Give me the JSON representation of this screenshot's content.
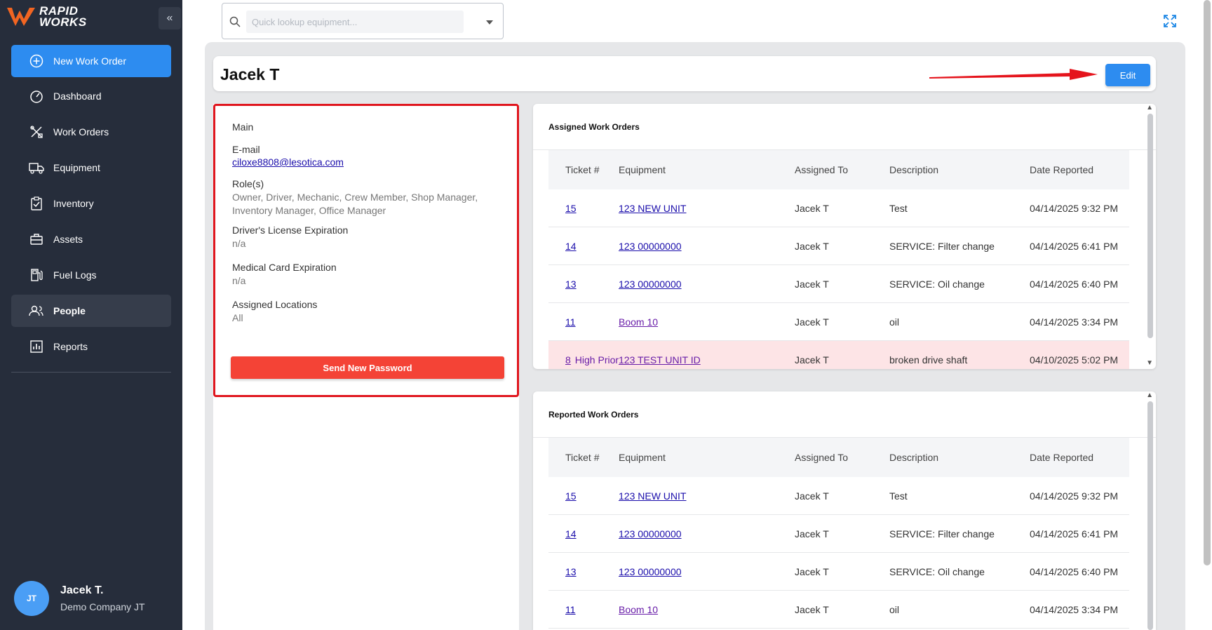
{
  "app": {
    "logo_line1": "RAPID",
    "logo_line2": "WORKS",
    "collapse_label": "«",
    "brand_color": "#f26522"
  },
  "sidebar": {
    "new_work_order": "New Work Order",
    "items": [
      {
        "label": "Dashboard",
        "icon": "gauge-icon"
      },
      {
        "label": "Work Orders",
        "icon": "tools-icon"
      },
      {
        "label": "Equipment",
        "icon": "truck-icon"
      },
      {
        "label": "Inventory",
        "icon": "clipboard-check-icon"
      },
      {
        "label": "Assets",
        "icon": "briefcase-icon"
      },
      {
        "label": "Fuel Logs",
        "icon": "fuel-pump-icon"
      },
      {
        "label": "People",
        "icon": "users-icon",
        "active": true
      },
      {
        "label": "Reports",
        "icon": "bar-chart-icon"
      }
    ],
    "user": {
      "initials": "JT",
      "name": "Jacek T.",
      "company": "Demo Company JT"
    }
  },
  "search": {
    "placeholder": "Quick lookup equipment..."
  },
  "header": {
    "title": "Jacek T",
    "edit_label": "Edit"
  },
  "profile": {
    "section": "Main",
    "email_label": "E-mail",
    "email_value": "ciloxe8808@lesotica.com",
    "roles_label": "Role(s)",
    "roles_value": "Owner, Driver, Mechanic, Crew Member, Shop Manager, Inventory Manager, Office Manager",
    "license_label": "Driver's License Expiration",
    "license_value": "n/a",
    "medical_label": "Medical Card Expiration",
    "medical_value": "n/a",
    "locations_label": "Assigned Locations",
    "locations_value": "All",
    "send_password_label": "Send New Password"
  },
  "columns": {
    "ticket": "Ticket #",
    "equipment": "Equipment",
    "assigned": "Assigned To",
    "description": "Description",
    "date": "Date Reported"
  },
  "assigned": {
    "title": "Assigned Work Orders",
    "rows": [
      {
        "ticket": "15",
        "priority": "",
        "equipment": "123 NEW UNIT",
        "assigned": "Jacek T",
        "description": "Test",
        "date": "04/14/2025 9:32 PM"
      },
      {
        "ticket": "14",
        "priority": "",
        "equipment": "123 00000000",
        "assigned": "Jacek T",
        "description": "SERVICE: Filter change",
        "date": "04/14/2025 6:41 PM"
      },
      {
        "ticket": "13",
        "priority": "",
        "equipment": "123 00000000",
        "assigned": "Jacek T",
        "description": "SERVICE: Oil change",
        "date": "04/14/2025 6:40 PM"
      },
      {
        "ticket": "11",
        "priority": "",
        "equipment": "Boom 10",
        "assigned": "Jacek T",
        "description": "oil",
        "date": "04/14/2025 3:34 PM"
      },
      {
        "ticket": "8",
        "priority": "High Prior",
        "equipment": "123 TEST UNIT ID",
        "assigned": "Jacek T",
        "description": "broken drive shaft",
        "date": "04/10/2025 5:02 PM"
      }
    ]
  },
  "reported": {
    "title": "Reported Work Orders",
    "rows": [
      {
        "ticket": "15",
        "equipment": "123 NEW UNIT",
        "assigned": "Jacek T",
        "description": "Test",
        "date": "04/14/2025 9:32 PM"
      },
      {
        "ticket": "14",
        "equipment": "123 00000000",
        "assigned": "Jacek T",
        "description": "SERVICE: Filter change",
        "date": "04/14/2025 6:41 PM"
      },
      {
        "ticket": "13",
        "equipment": "123 00000000",
        "assigned": "Jacek T",
        "description": "SERVICE: Oil change",
        "date": "04/14/2025 6:40 PM"
      },
      {
        "ticket": "11",
        "equipment": "Boom 10",
        "assigned": "Jacek T",
        "description": "oil",
        "date": "04/14/2025 3:34 PM"
      }
    ]
  }
}
